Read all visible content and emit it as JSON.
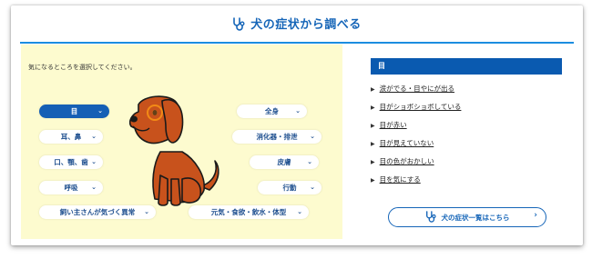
{
  "header": {
    "title": "犬の症状から調べる"
  },
  "left": {
    "prompt": "気になるところを選択してください。",
    "parts": [
      {
        "label": "目",
        "active": true
      },
      {
        "label": "耳、鼻"
      },
      {
        "label": "口、顎、歯"
      },
      {
        "label": "呼吸"
      },
      {
        "label": "飼い主さんが気づく異常"
      },
      {
        "label": "全身"
      },
      {
        "label": "消化器・排泄"
      },
      {
        "label": "皮膚"
      },
      {
        "label": "行動"
      },
      {
        "label": "元気・食欲・飲水・体型"
      }
    ]
  },
  "right": {
    "heading": "目",
    "symptoms": [
      "涙がでる・目やにが出る",
      "目がショボショボしている",
      "目が赤い",
      "目が見えていない",
      "目の色がおかしい",
      "目を気にする"
    ],
    "cta_label": "犬の症状一覧はこちら"
  },
  "colors": {
    "accent": "#1565b8",
    "panel": "#fdfbcf",
    "dog": "#c8521c"
  },
  "icons": {
    "header": "stethoscope-icon",
    "chevron": "chevron-down-icon",
    "list_bullet": "triangle-right-icon",
    "cta_arrow": "chevron-right-icon"
  }
}
